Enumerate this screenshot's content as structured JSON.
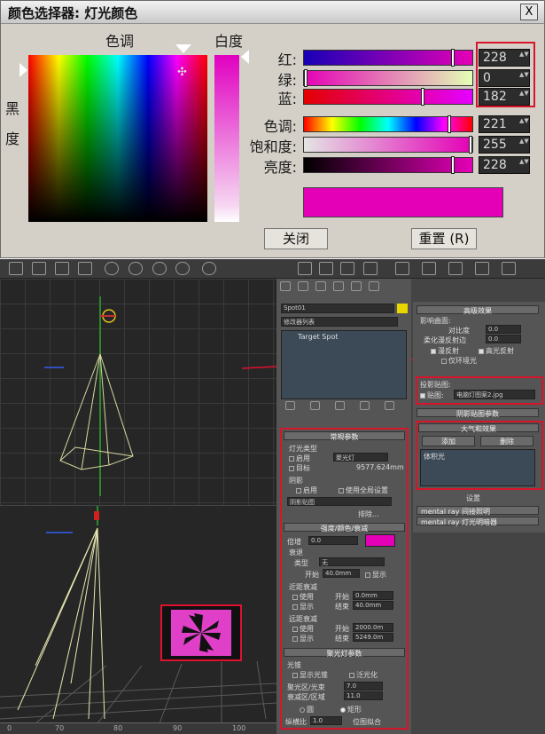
{
  "dialog": {
    "title": "颜色选择器: 灯光颜色",
    "close_glyph": "X",
    "hue_label": "色调",
    "whiteness_label": "白度",
    "blackness_label_1": "黑",
    "blackness_label_2": "度",
    "channels": [
      {
        "label": "红:",
        "value": "228",
        "level": 0.89
      },
      {
        "label": "绿:",
        "value": "0",
        "level": 0.0
      },
      {
        "label": "蓝:",
        "value": "182",
        "level": 0.71
      },
      {
        "label": "色调:",
        "value": "221",
        "level": 0.87
      },
      {
        "label": "饱和度:",
        "value": "255",
        "level": 1.0
      },
      {
        "label": "亮度:",
        "value": "228",
        "level": 0.89
      }
    ],
    "color": "#e400b6",
    "close_button": "关闭",
    "reset_button": "重置 (R)"
  },
  "max": {
    "object_name": "Spot01",
    "modifier_list": "修改器列表",
    "stack_item": "Target Spot",
    "general": {
      "title": "常规参数",
      "light_type_label": "灯光类型",
      "enable_label": "启用",
      "type_value": "聚光灯",
      "target_label": "目标",
      "target_distance": "9577.624mm",
      "shadow_label": "阴影",
      "shadow_enable": "启用",
      "global_settings": "使用全局设置",
      "shadow_type": "阴影贴图",
      "exclude_button": "排除..."
    },
    "intensity": {
      "title": "强度/颜色/衰减",
      "multiplier_label": "倍增",
      "multiplier_value": "0.0",
      "decay_label": "衰退",
      "type_label": "类型",
      "type_value": "无",
      "start_label": "开始",
      "start_value": "40.0mm",
      "show_label": "显示",
      "near_atten": "近距衰减",
      "use_label": "使用",
      "near_start": "0.0mm",
      "end_label": "结束",
      "near_end": "40.0mm",
      "far_atten": "远距衰减",
      "far_start": "2000.0m",
      "far_end": "5249.0m"
    },
    "spot": {
      "title": "聚光灯参数",
      "cone_label": "光锥",
      "show_cone": "显示光锥",
      "overshoot": "泛光化",
      "hotspot_label": "聚光区/光束",
      "hotspot_value": "7.0",
      "falloff_label": "衰减区/区域",
      "falloff_value": "11.0",
      "circle": "圆",
      "rect": "矩形",
      "aspect_label": "纵横比",
      "aspect_value": "1.0",
      "bitmap_fit": "位图拟合"
    },
    "advanced": {
      "title": "高级效果",
      "affect_surface": "影响曲面:",
      "contrast_label": "对比度",
      "contrast_value": "0.0",
      "soften_label": "柔化漫反射边",
      "soften_value": "0.0",
      "diffuse": "漫反射",
      "specular": "高光反射",
      "ambient_only": "仅环境光",
      "projector_label": "投影贴图:",
      "map_label": "贴图:",
      "map_file": "电脑灯图案2.jpg",
      "shadow_params": "阴影贴图参数"
    },
    "atmos": {
      "title": "大气和效果",
      "add": "添加",
      "delete": "删除",
      "item": "体积光",
      "setup": "设置"
    },
    "mentalray": [
      "mental ray 间接照明",
      "mental ray 灯光明暗器"
    ],
    "ruler": [
      "0",
      "70",
      "80",
      "90",
      "100"
    ]
  }
}
